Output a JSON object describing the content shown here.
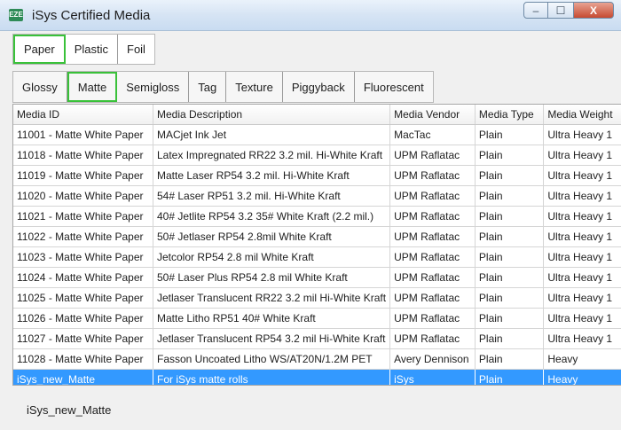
{
  "window": {
    "title": "iSys Certified Media",
    "icon_text": "EZE"
  },
  "caption": {
    "minimize": "–",
    "maximize": "☐",
    "close": "X"
  },
  "material_tabs": [
    {
      "label": "Paper",
      "active": true
    },
    {
      "label": "Plastic",
      "active": false
    },
    {
      "label": "Foil",
      "active": false
    }
  ],
  "finish_tabs": [
    {
      "label": "Glossy",
      "active": false
    },
    {
      "label": "Matte",
      "active": true
    },
    {
      "label": "Semigloss",
      "active": false
    },
    {
      "label": "Tag",
      "active": false
    },
    {
      "label": "Texture",
      "active": false
    },
    {
      "label": "Piggyback",
      "active": false
    },
    {
      "label": "Fluorescent",
      "active": false
    }
  ],
  "grid": {
    "columns": [
      "Media ID",
      "Media Description",
      "Media Vendor",
      "Media Type",
      "Media Weight"
    ],
    "rows": [
      [
        "11001 - Matte White Paper",
        "MACjet Ink Jet",
        "MacTac",
        "Plain",
        "Ultra Heavy 1"
      ],
      [
        "11018 - Matte White Paper",
        "Latex Impregnated RR22 3.2 mil. Hi-White Kraft",
        "UPM Raflatac",
        "Plain",
        "Ultra Heavy 1"
      ],
      [
        "11019 - Matte White Paper",
        "Matte Laser RP54 3.2 mil. Hi-White Kraft",
        "UPM Raflatac",
        "Plain",
        "Ultra Heavy 1"
      ],
      [
        "11020 - Matte White Paper",
        "54# Laser RP51 3.2 mil. Hi-White Kraft",
        "UPM Raflatac",
        "Plain",
        "Ultra Heavy 1"
      ],
      [
        "11021 - Matte White Paper",
        "40# Jetlite RP54 3.2 35# White Kraft (2.2 mil.)",
        "UPM Raflatac",
        "Plain",
        "Ultra Heavy 1"
      ],
      [
        "11022 - Matte White Paper",
        "50# Jetlaser RP54 2.8mil White Kraft",
        "UPM Raflatac",
        "Plain",
        "Ultra Heavy 1"
      ],
      [
        "11023 - Matte White Paper",
        "Jetcolor RP54 2.8 mil White Kraft",
        "UPM Raflatac",
        "Plain",
        "Ultra Heavy 1"
      ],
      [
        "11024 - Matte White Paper",
        "50# Laser Plus RP54 2.8 mil White Kraft",
        "UPM Raflatac",
        "Plain",
        "Ultra Heavy 1"
      ],
      [
        "11025 - Matte White Paper",
        "Jetlaser Translucent RR22 3.2 mil Hi-White Kraft",
        "UPM Raflatac",
        "Plain",
        "Ultra Heavy 1"
      ],
      [
        "11026 - Matte White Paper",
        "Matte Litho RP51 40# White Kraft",
        "UPM Raflatac",
        "Plain",
        "Ultra Heavy 1"
      ],
      [
        "11027 - Matte White Paper",
        "Jetlaser Translucent RP54 3.2 mil Hi-White Kraft",
        "UPM Raflatac",
        "Plain",
        "Ultra Heavy 1"
      ],
      [
        "11028 - Matte White Paper",
        "Fasson Uncoated Litho WS/AT20N/1.2M PET",
        "Avery Dennison",
        "Plain",
        "Heavy"
      ],
      [
        "iSys_new_Matte",
        "For iSys matte rolls",
        "iSys",
        "Plain",
        "Heavy"
      ]
    ],
    "selected_row": 12
  },
  "status_text": "iSys_new_Matte",
  "colors": {
    "selection": "#3399ff",
    "active_tab_border": "#39c139"
  }
}
